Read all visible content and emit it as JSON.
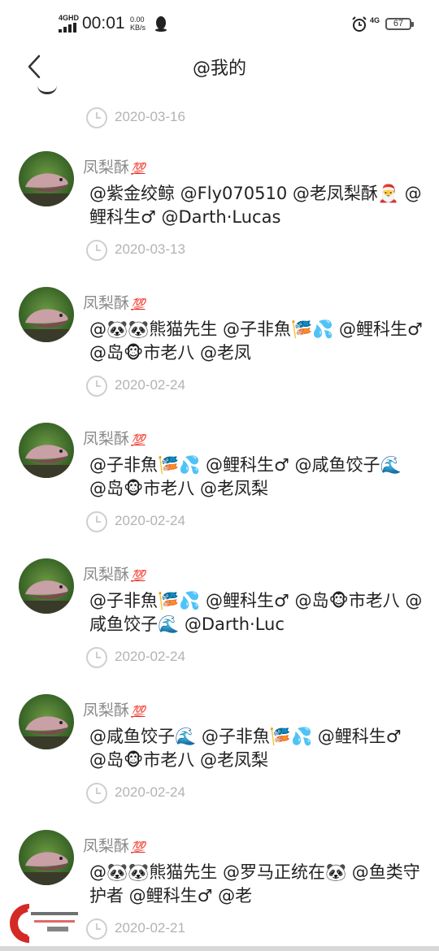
{
  "status_bar": {
    "network": "4GHD",
    "time": "00:01",
    "speed_value": "0.00",
    "speed_unit": "KB/s",
    "network_right": "4G",
    "battery": "67"
  },
  "nav": {
    "title": "@我的"
  },
  "top_date": "2020-03-16",
  "posts": [
    {
      "username": "凤梨酥",
      "badge": "💯",
      "message": "@紫金绞鲸 @Fly070510 @老凤梨酥🎅 @鲤科生♂ @Darth·Lucas",
      "date": "2020-03-13"
    },
    {
      "username": "凤梨酥",
      "badge": "💯",
      "message": "@🐼🐼熊猫先生 @子非魚🎏💦 @鲤科生♂ @岛🐵市老八 @老凤",
      "date": "2020-02-24"
    },
    {
      "username": "凤梨酥",
      "badge": "💯",
      "message": "@子非魚🎏💦 @鲤科生♂ @咸鱼饺子🌊 @岛🐵市老八 @老凤梨",
      "date": "2020-02-24"
    },
    {
      "username": "凤梨酥",
      "badge": "💯",
      "message": "@子非魚🎏💦 @鲤科生♂ @岛🐵市老八 @咸鱼饺子🌊 @Darth·Luc",
      "date": "2020-02-24"
    },
    {
      "username": "凤梨酥",
      "badge": "💯",
      "message": "@咸鱼饺子🌊 @子非魚🎏💦 @鲤科生♂ @岛🐵市老八 @老凤梨",
      "date": "2020-02-24"
    },
    {
      "username": "凤梨酥",
      "badge": "💯",
      "message": "@🐼🐼熊猫先生 @罗马正统在🐼 @鱼类守护者 @鲤科生♂ @老",
      "date": "2020-02-21"
    }
  ],
  "icons": {
    "back": "chevron-left-icon",
    "clock": "clock-icon",
    "badge": "hundred-points-icon"
  },
  "colors": {
    "date_text": "#b3b3b3",
    "username_text": "#8a8a8a",
    "badge_red": "#e0282a"
  }
}
